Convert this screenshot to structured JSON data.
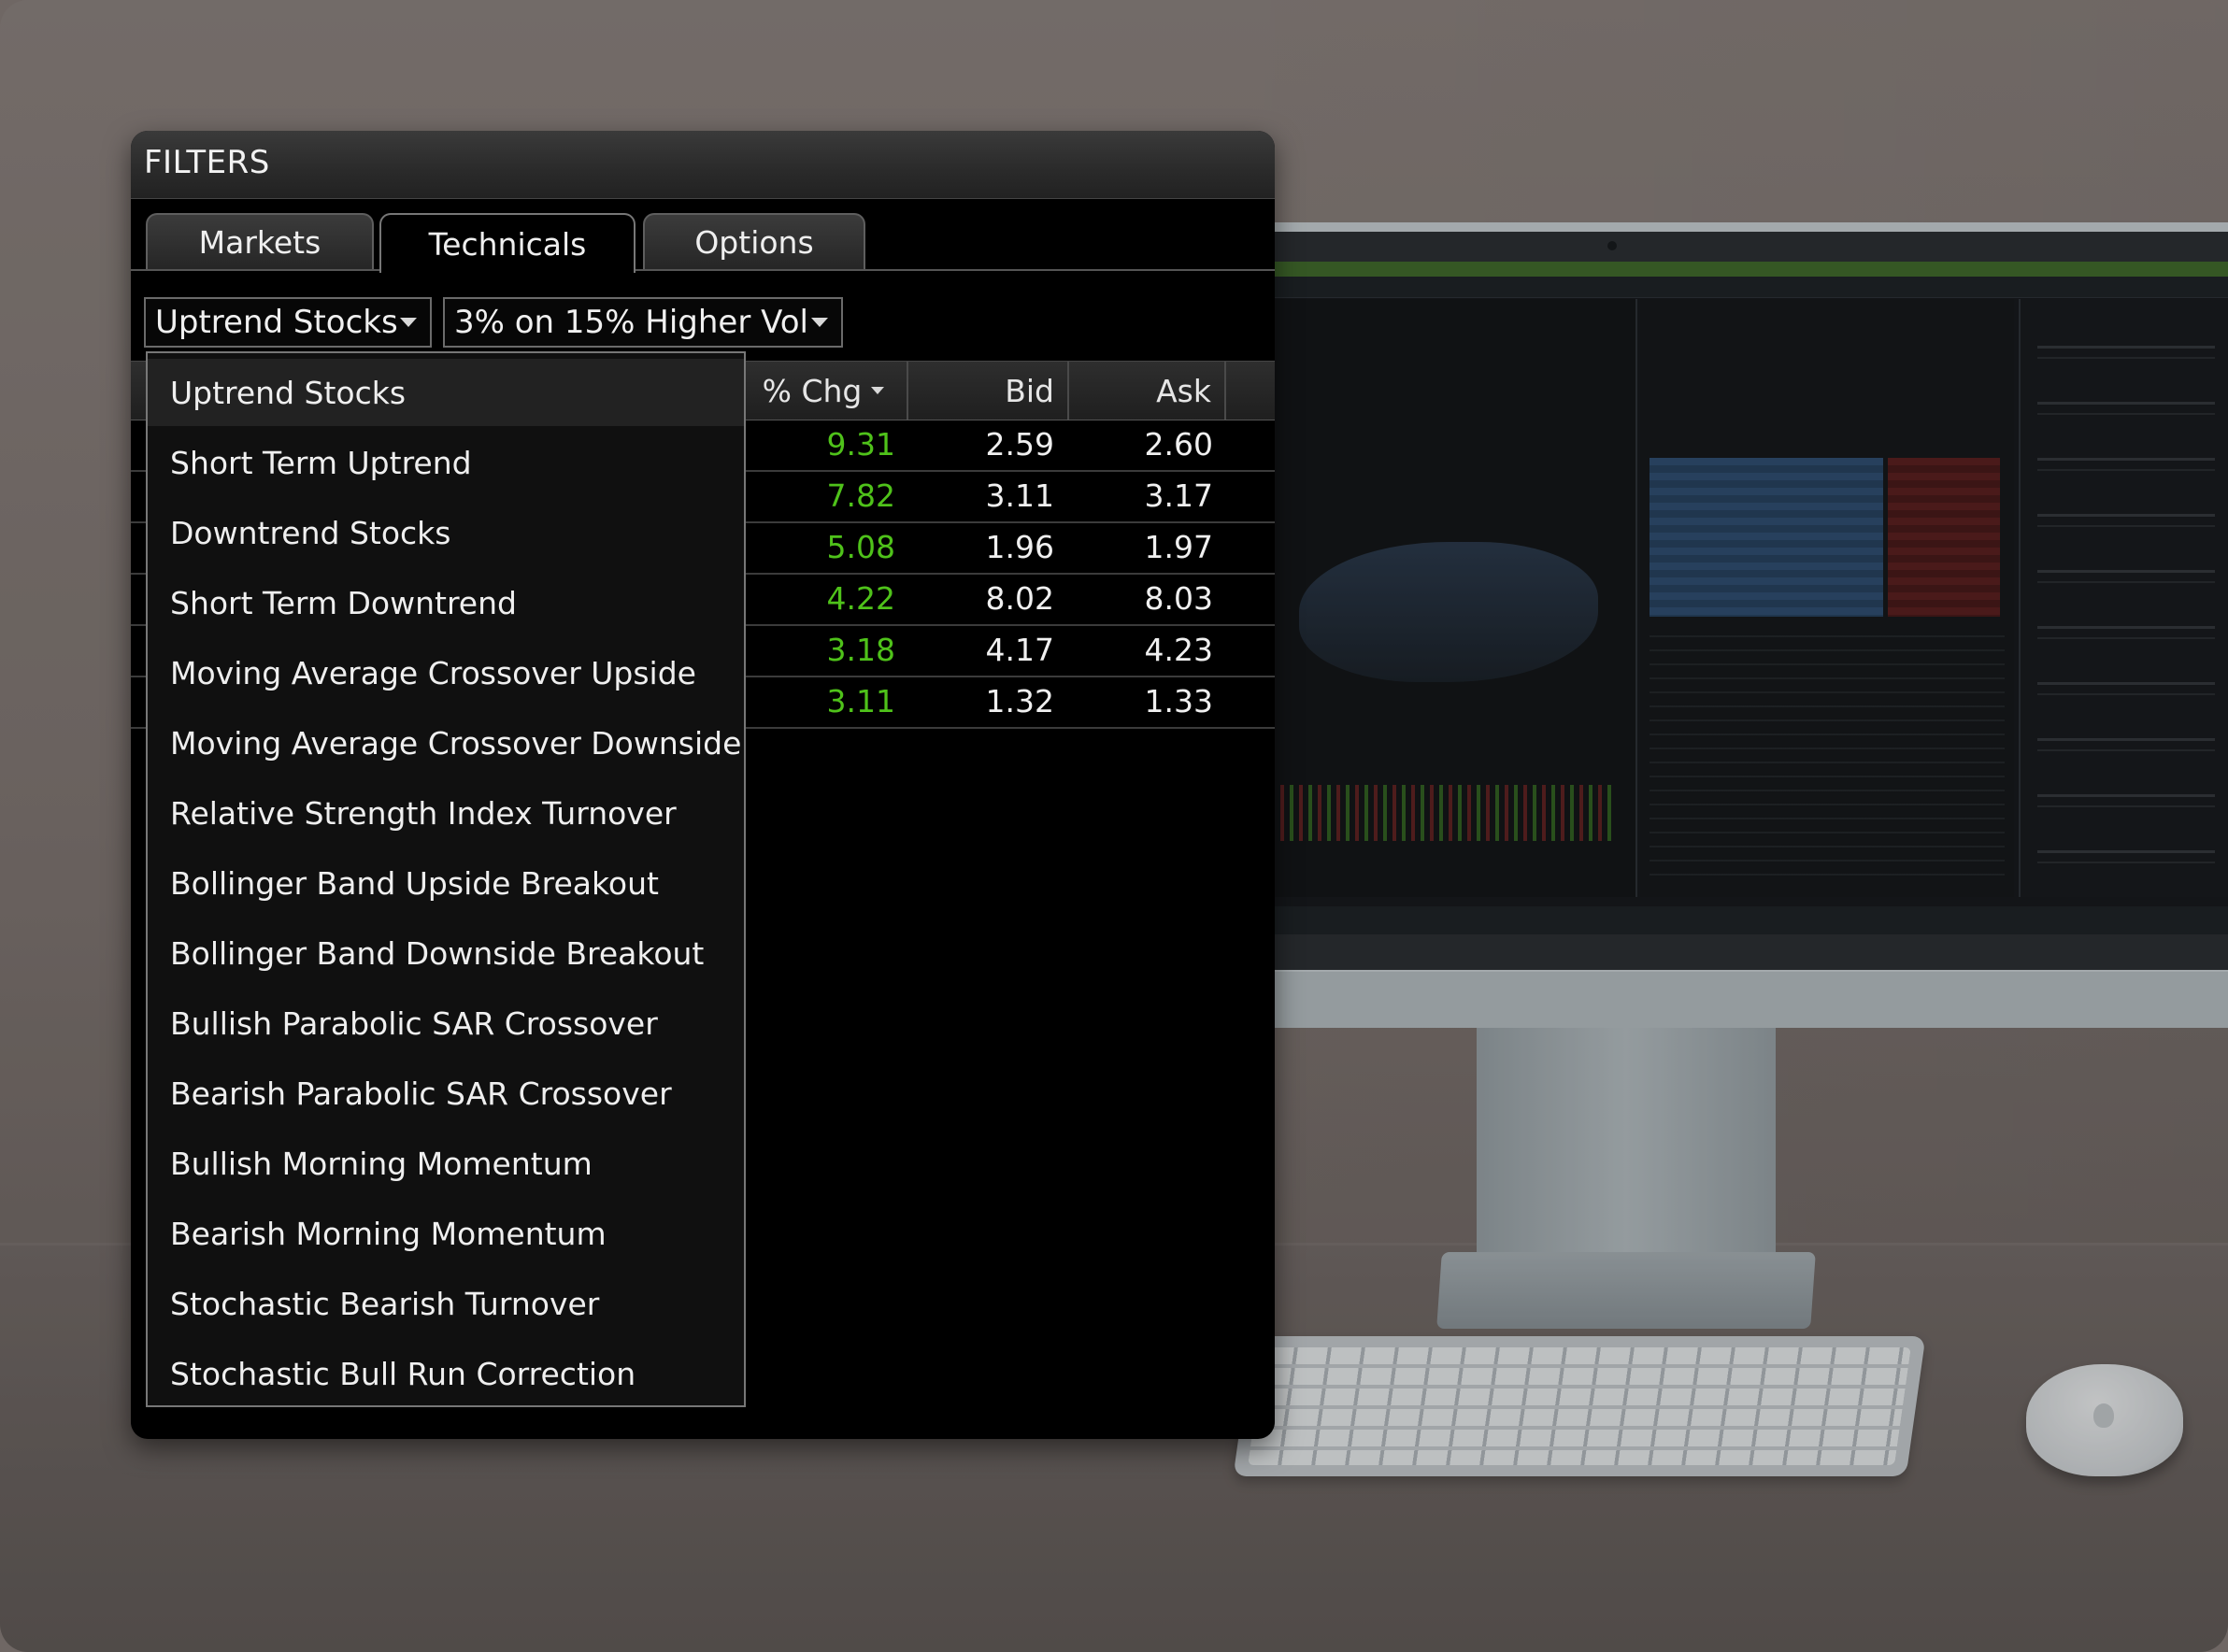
{
  "filters": {
    "title": "FILTERS",
    "tabs": [
      {
        "label": "Markets",
        "active": false
      },
      {
        "label": "Technicals",
        "active": true
      },
      {
        "label": "Options",
        "active": false
      }
    ],
    "selects": [
      {
        "value": "Uptrend Stocks"
      },
      {
        "value": "3% on 15% Higher Vol"
      }
    ],
    "table": {
      "columns": [
        "% Chg",
        "Bid",
        "Ask"
      ],
      "rows": [
        {
          "chg": "9.31",
          "bid": "2.59",
          "ask": "2.60"
        },
        {
          "chg": "7.82",
          "bid": "3.11",
          "ask": "3.17"
        },
        {
          "chg": "5.08",
          "bid": "1.96",
          "ask": "1.97"
        },
        {
          "chg": "4.22",
          "bid": "8.02",
          "ask": "8.03"
        },
        {
          "chg": "3.18",
          "bid": "4.17",
          "ask": "4.23"
        },
        {
          "chg": "3.11",
          "bid": "1.32",
          "ask": "1.33"
        }
      ]
    },
    "dropdown": {
      "selected_index": 0,
      "options": [
        "Uptrend Stocks",
        "Short Term Uptrend",
        "Downtrend Stocks",
        "Short Term Downtrend",
        "Moving Average Crossover Upside",
        "Moving Average Crossover Downside",
        "Relative Strength Index Turnover",
        "Bollinger Band Upside Breakout",
        "Bollinger Band Downside Breakout",
        "Bullish Parabolic SAR Crossover",
        "Bearish Parabolic SAR Crossover",
        "Bullish Morning Momentum",
        "Bearish Morning Momentum",
        "Stochastic Bearish Turnover",
        "Stochastic Bull Run Correction"
      ]
    }
  },
  "colors": {
    "positive_change": "#4fc21a",
    "panel_background": "#000000",
    "text": "#efefef"
  }
}
